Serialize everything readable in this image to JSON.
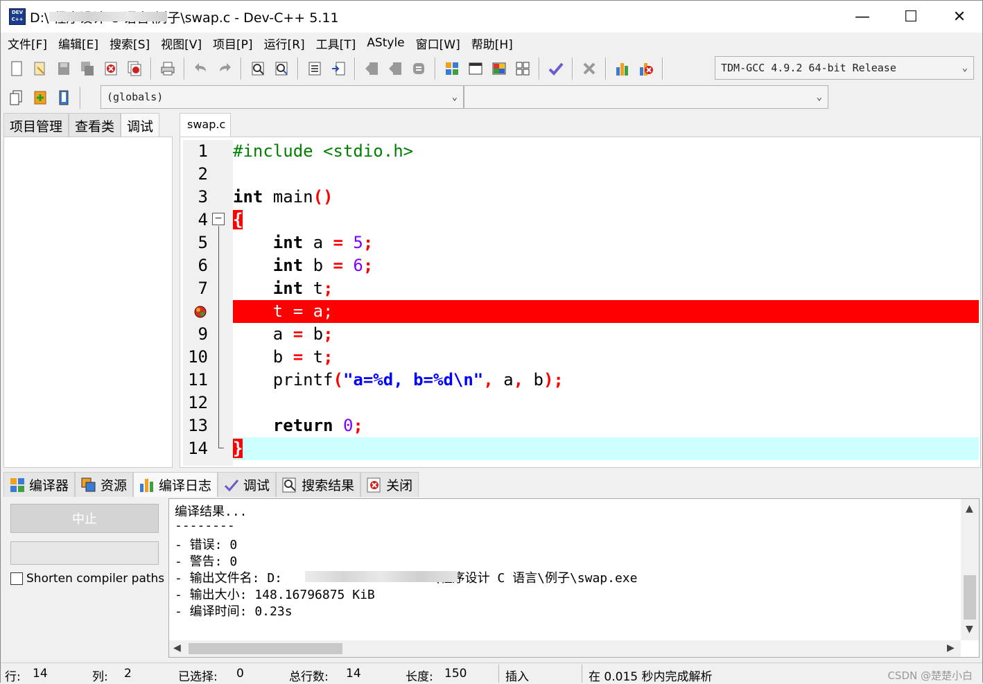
{
  "window": {
    "title": "D:\\                    程序设计 C 语言\\例子\\swap.c - Dev-C++ 5.11",
    "minimize": "—",
    "maximize": "☐",
    "close": "✕"
  },
  "menu": [
    "文件[F]",
    "编辑[E]",
    "搜索[S]",
    "视图[V]",
    "项目[P]",
    "运行[R]",
    "工具[T]",
    "AStyle",
    "窗口[W]",
    "帮助[H]"
  ],
  "toolbar": {
    "compiler_select": "TDM-GCC 4.9.2 64-bit Release",
    "scope_select": "(globals)",
    "symbol_select": ""
  },
  "left_panel": {
    "tabs": [
      "项目管理",
      "查看类",
      "调试"
    ],
    "active_tab": "调试"
  },
  "editor": {
    "tab_label": "swap.c",
    "breakpoint_line": 8,
    "current_line": 14,
    "lines": [
      {
        "n": "1"
      },
      {
        "n": "2"
      },
      {
        "n": "3"
      },
      {
        "n": "4"
      },
      {
        "n": "5"
      },
      {
        "n": "6"
      },
      {
        "n": "7"
      },
      {
        "n": "8"
      },
      {
        "n": "9"
      },
      {
        "n": "10"
      },
      {
        "n": "11"
      },
      {
        "n": "12"
      },
      {
        "n": "13"
      },
      {
        "n": "14"
      }
    ]
  },
  "bottom_panel": {
    "tabs": [
      "编译器",
      "资源",
      "编译日志",
      "调试",
      "搜索结果",
      "关闭"
    ],
    "active_tab": "编译日志",
    "abort_button": "中止",
    "shorten_paths_label": "Shorten compiler paths",
    "log": [
      "编译结果...",
      "--------",
      "- 错误: 0",
      "- 警告: 0",
      "- 输出文件名: D:                    \\程序设计 C 语言\\例子\\swap.exe",
      "- 输出大小: 148.16796875 KiB",
      "- 编译时间: 0.23s"
    ]
  },
  "status_bar": {
    "row_label": "行:",
    "row_value": "14",
    "col_label": "列:",
    "col_value": "2",
    "sel_label": "已选择:",
    "sel_value": "0",
    "total_label": "总行数:",
    "total_value": "14",
    "len_label": "长度:",
    "len_value": "150",
    "mode": "插入",
    "parse_msg": "在 0.015 秒内完成解析",
    "watermark": "CSDN @楚楚小白"
  },
  "colors": {
    "breakpoint_line": "#ff0000",
    "current_line": "#ccffff",
    "keyword": "#000000",
    "preprocessor": "#008000",
    "number": "#8000ff",
    "string": "#0000ff"
  }
}
